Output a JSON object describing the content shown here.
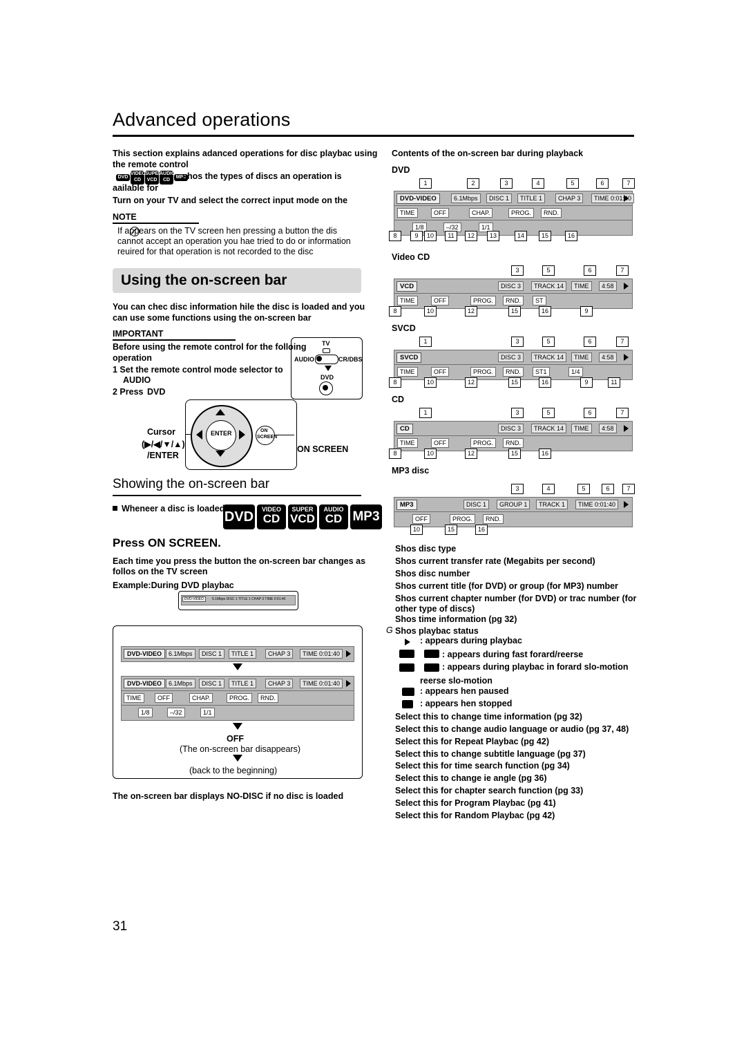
{
  "page": {
    "number": "31",
    "title": "Advanced operations"
  },
  "intro": {
    "line1": "This section explains adanced operations for disc playbac using",
    "line2": "the remote control",
    "line3": "shos the types of discs an operation is",
    "line4": "aailable for",
    "line5": "Turn on your TV and select the correct input mode on the"
  },
  "note": {
    "label": "NOTE",
    "line1": "If        appears on the TV screen hen pressing a button the dis",
    "line2": "cannot accept an operation you hae tried to do or information",
    "line3": "reuired for that operation is not recorded to the disc"
  },
  "section": {
    "heading": "Using the on-screen bar",
    "body1": "You can chec disc information hile the disc is loaded and you",
    "body2": "can use some functions using the on-screen bar"
  },
  "important": {
    "label": "IMPORTANT",
    "line1": "Before using the remote control for the folloing",
    "line2": "operation",
    "step1": "1  Set the remote control mode selector to",
    "step1b": "AUDIO",
    "step2": "2  Press",
    "step2b": "DVD"
  },
  "selector": {
    "tv": "TV",
    "audio": "AUDIO",
    "vcrdbs": "VCR/DBS",
    "dvd": "DVD"
  },
  "cursor": {
    "label": "Cursor",
    "keys": "(▶/◀/▼/▲)",
    "enter": "/ENTER",
    "enter_btn": "ENTER",
    "onscreen_btn_l1": "ON",
    "onscreen_btn_l2": "SCREEN",
    "onscreen_label": "ON SCREEN"
  },
  "showing": {
    "heading": "Showing the on-screen bar",
    "bullet": "Wheneer a disc is loaded",
    "press": "Press ON SCREEN.",
    "body1": "Each time you press the button the on-screen bar changes as",
    "body2": "follos on the TV screen",
    "example": "Example:During DVD playbac",
    "off": "OFF",
    "off_sub": "(The on-screen bar disappears)",
    "back": "(back to the beginning)",
    "nodisc": "The on-screen bar displays NO-DISC if no disc is loaded"
  },
  "right": {
    "heading": "Contents of the on-screen bar during playback",
    "labels": {
      "dvd": "DVD",
      "videocd": "Video CD",
      "svcd": "SVCD",
      "cd": "CD",
      "mp3": "MP3 disc"
    }
  },
  "bars": {
    "dvd": {
      "tag": "DVD-VIDEO",
      "rate": "6.1Mbps",
      "disc": "DISC 1",
      "title": "TITLE  1",
      "chap": "CHAP  3",
      "time": "TIME 0:01:40",
      "row2": [
        "TIME",
        "OFF",
        "CHAP.",
        "PROG.",
        "RND."
      ],
      "row3": [
        "1/8",
        "–/32",
        "1/1"
      ],
      "numbers_top": [
        "1",
        "2",
        "3",
        "4",
        "5",
        "6",
        "7"
      ],
      "numbers_bottom": [
        "8",
        "9",
        "10",
        "11",
        "12",
        "13",
        "14",
        "15",
        "16"
      ]
    },
    "vcd": {
      "tag": "VCD",
      "disc": "DISC 3",
      "track": "TRACK 14",
      "time_label": "TIME",
      "time": "4:58",
      "row2": [
        "TIME",
        "OFF",
        "PROG.",
        "RND.",
        "ST"
      ],
      "numbers_top": [
        "3",
        "5",
        "6",
        "7"
      ],
      "numbers_bottom": [
        "8",
        "10",
        "12",
        "15",
        "16",
        "9"
      ]
    },
    "svcd": {
      "tag": "SVCD",
      "disc": "DISC 3",
      "track": "TRACK 14",
      "time_label": "TIME",
      "time": "4:58",
      "row2": [
        "TIME",
        "OFF",
        "PROG.",
        "RND.",
        "ST1",
        "1/4"
      ],
      "numbers_top": [
        "1",
        "3",
        "5",
        "6",
        "7"
      ],
      "numbers_bottom": [
        "8",
        "10",
        "12",
        "15",
        "16",
        "9",
        "11"
      ]
    },
    "cd": {
      "tag": "CD",
      "disc": "DISC 3",
      "track": "TRACK 14",
      "time_label": "TIME",
      "time": "4:58",
      "row2": [
        "TIME",
        "OFF",
        "PROG.",
        "RND."
      ],
      "numbers_top": [
        "1",
        "3",
        "5",
        "6",
        "7"
      ],
      "numbers_bottom": [
        "8",
        "10",
        "12",
        "15",
        "16"
      ]
    },
    "mp3": {
      "tag": "MP3",
      "disc": "DISC 1",
      "group": "GROUP  1",
      "track": "TRACK  1",
      "time": "TIME 0:01:40",
      "row2": [
        "OFF",
        "PROG.",
        "RND."
      ],
      "numbers_top": [
        "3",
        "4",
        "5",
        "6",
        "7"
      ],
      "numbers_bottom": [
        "10",
        "15",
        "16"
      ]
    }
  },
  "legend": {
    "items": [
      "Shos disc type",
      "Shos current transfer rate (Megabits per second)",
      "Shos disc number",
      "Shos current title (for DVD) or group (for MP3) number",
      "Shos current chapter number (for DVD) or trac number (for",
      "other type of discs)",
      "Shos time information (pg 32)",
      "Shos playbac status"
    ],
    "status": [
      ": appears during playbac",
      ": appears during fast forard/reerse",
      ": appears during playbac in forard slo-motion",
      "reerse slo-motion",
      ": appears hen paused",
      ": appears hen stopped"
    ],
    "selects": [
      "Select this to change time information (pg 32)",
      "Select this to change audio language or audio (pg 37, 48)",
      "Select this for Repeat Playbac (pg 42)",
      "Select this to change subtitle language (pg 37)",
      "Select this for time search function (pg 34)",
      "Select this to change ie angle (pg 36)",
      "Select this for chapter search function (pg 33)",
      "Select this for Program Playbac (pg 41)",
      "Select this for Random Playbac (pg 42)"
    ]
  },
  "badges": {
    "mini": [
      "DVD",
      "VIDEO CD",
      "SUPER VCD",
      "CD",
      "MP3"
    ],
    "big": [
      {
        "l1": "DVD"
      },
      {
        "l1": "VIDEO",
        "l2": "CD"
      },
      {
        "l1": "SUPER",
        "l2": "VCD"
      },
      {
        "l1": "AUDIO",
        "l2": "CD"
      },
      {
        "l1": "MP3"
      }
    ]
  },
  "colors": {
    "bar_bg": "#b9b9b9",
    "cell_bg": "#e4e4e4",
    "heading_bg": "#d9d9d9"
  }
}
